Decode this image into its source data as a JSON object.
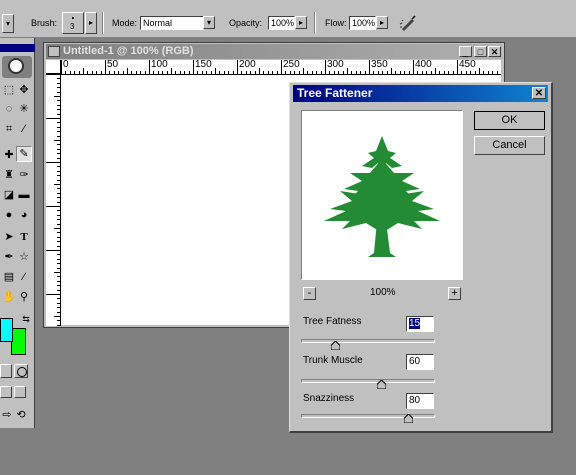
{
  "options_bar": {
    "brush_label": "Brush:",
    "brush_size": "3",
    "mode_label": "Mode:",
    "mode_value": "Normal",
    "opacity_label": "Opacity:",
    "opacity_value": "100%",
    "flow_label": "Flow:",
    "flow_value": "100%"
  },
  "document": {
    "title": "Untitled-1 @ 100% (RGB)",
    "ruler_labels": [
      "0",
      "50",
      "100",
      "150",
      "200",
      "250",
      "300",
      "350",
      "400",
      "450"
    ]
  },
  "toolbox": {
    "foreground_color": "#00ffff",
    "background_color": "#00ff00"
  },
  "dialog": {
    "title": "Tree Fattener",
    "ok_label": "OK",
    "cancel_label": "Cancel",
    "zoom_level": "100%",
    "zoom_out_label": "-",
    "zoom_in_label": "+",
    "tree_color": "#228b33",
    "params": [
      {
        "label": "Tree Fatness",
        "value": "15",
        "slider": 0.25
      },
      {
        "label": "Trunk Muscle",
        "value": "60",
        "slider": 0.6
      },
      {
        "label": "Snazziness",
        "value": "80",
        "slider": 0.8
      }
    ]
  }
}
